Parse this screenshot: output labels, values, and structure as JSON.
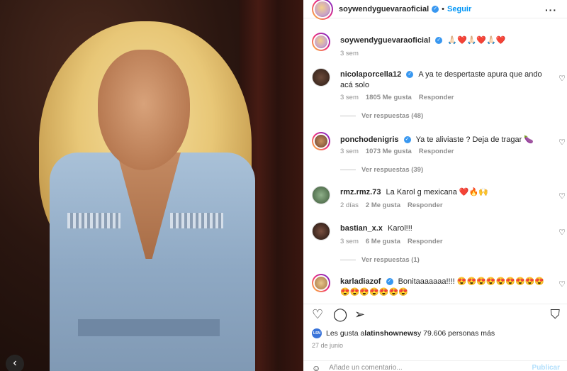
{
  "post_author": {
    "username": "soywendyguevaraoficial",
    "follow_label": "Seguir",
    "separator": "•",
    "more_icon": "more-horizontal-icon"
  },
  "caption": {
    "username": "soywendyguevaraoficial",
    "text": "🙏🏻❤️🙏🏻❤️🙏🏻❤️",
    "time": "3 sem"
  },
  "comments": [
    {
      "username": "nicolaporcella12",
      "verified": true,
      "text": "A ya te despertaste apura que ando acá solo",
      "time": "3 sem",
      "likes": "1805 Me gusta",
      "reply": "Responder",
      "view_replies": "Ver respuestas (48)"
    },
    {
      "username": "ponchodenigris",
      "verified": true,
      "text": "Ya te aliviaste ? Deja de tragar 🍆",
      "time": "3 sem",
      "likes": "1073 Me gusta",
      "reply": "Responder",
      "view_replies": "Ver respuestas (39)"
    },
    {
      "username": "rmz.rmz.73",
      "verified": false,
      "text": "La Karol g mexicana ❤️🔥🙌",
      "time": "2 días",
      "likes": "2 Me gusta",
      "reply": "Responder"
    },
    {
      "username": "bastian_x.x",
      "verified": false,
      "text": "Karol!!!",
      "time": "3 sem",
      "likes": "6 Me gusta",
      "reply": "Responder",
      "view_replies": "Ver respuestas (1)"
    },
    {
      "username": "karladiazof",
      "verified": true,
      "text": "Bonitaaaaaaa!!!! 😍😍😍😍😍😍😍😍😍😍😍😍😍😍😍😍"
    }
  ],
  "actions": {
    "like_icon": "heart-icon",
    "comment_icon": "comment-icon",
    "share_icon": "share-icon",
    "save_icon": "bookmark-icon"
  },
  "likes": {
    "prefix": "Les gusta a ",
    "user": "latinshownews",
    "suffix": " y 79.606 personas más",
    "mini_avatar_text": "LSN"
  },
  "date": "27 de junio",
  "add_comment": {
    "placeholder": "Añade un comentario...",
    "publish_label": "Publicar"
  },
  "colors": {
    "accent": "#0095f6",
    "verified": "#3897f0",
    "muted": "#8e8e8e",
    "heart": "#ed4956"
  }
}
